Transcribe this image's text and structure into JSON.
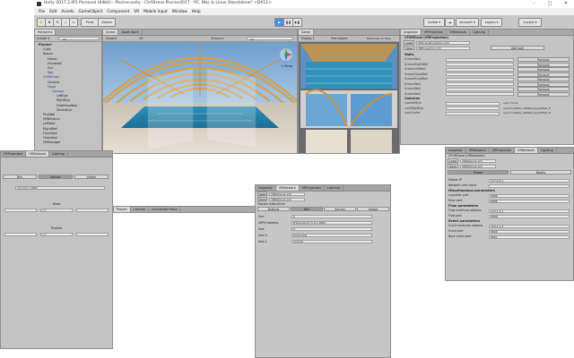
{
  "window": {
    "title": "Unity 2017.2.0f1 Personal (64bit) - Piscine.unity - CtrlStress-Piscine2017 - PC, Mac & Linux Standalone* <DX11>",
    "controls": [
      "–",
      "□",
      "✕"
    ]
  },
  "menu": [
    "File",
    "Edit",
    "Assets",
    "GameObject",
    "Component",
    "VR",
    "Mobile Input",
    "Window",
    "Help"
  ],
  "toolbar": {
    "pivot": "Pivot",
    "global": "Global",
    "collab": "Collab ▾",
    "account": "Account ▾",
    "layers": "Layers ▾",
    "layout": "Layout ▾"
  },
  "hierarchy": {
    "tab": "Hierarchy",
    "create": "Create ▾",
    "search": "All",
    "items": [
      {
        "label": "Piscine*",
        "depth": 0,
        "blue": false
      },
      {
        "label": "Cube",
        "depth": 1,
        "blue": false
      },
      {
        "label": "Bassin",
        "depth": 1,
        "blue": false
      },
      {
        "label": "Diesel",
        "depth": 2,
        "blue": false
      },
      {
        "label": "Handzest",
        "depth": 2,
        "blue": false
      },
      {
        "label": "Sun",
        "depth": 2,
        "blue": false
      },
      {
        "label": "Sun",
        "depth": 2,
        "blue": false
      },
      {
        "label": "CXVRCave",
        "depth": 1,
        "blue": true
      },
      {
        "label": "Camera",
        "depth": 2,
        "blue": false
      },
      {
        "label": "Head",
        "depth": 2,
        "blue": true
      },
      {
        "label": "Cyclops",
        "depth": 3,
        "blue": true
      },
      {
        "label": "LeftEye",
        "depth": 4,
        "blue": false
      },
      {
        "label": "RightEye",
        "depth": 4,
        "blue": false
      },
      {
        "label": "FadeHeadBox",
        "depth": 4,
        "blue": false
      },
      {
        "label": "StereoEye",
        "depth": 4,
        "blue": false
      },
      {
        "label": "PhyWall",
        "depth": 1,
        "blue": false
      },
      {
        "label": "VRNetwork",
        "depth": 1,
        "blue": false
      },
      {
        "label": "LeftWall",
        "depth": 1,
        "blue": false
      },
      {
        "label": "RightWall",
        "depth": 1,
        "blue": false
      },
      {
        "label": "FrontWall",
        "depth": 1,
        "blue": false
      },
      {
        "label": "FloorWall",
        "depth": 1,
        "blue": false
      },
      {
        "label": "VRManager",
        "depth": 1,
        "blue": false
      }
    ]
  },
  "scene": {
    "tabs": [
      "Scene",
      "Asset Store"
    ],
    "shaded": "Shaded",
    "mode2d": "2D",
    "gizmos": "Gizmos ▾",
    "search": "All",
    "persp": "< Persp"
  },
  "game": {
    "tabs": [
      "Display 1",
      "Free Aspect"
    ],
    "scale": "Scale",
    "maximize": "Maximize On Play"
  },
  "inspector": {
    "tabs": [
      "Inspector",
      "VRProjection",
      "VRNetwork",
      "Lighting"
    ],
    "header": "CFVMCave (VRProjection)",
    "load": "Load",
    "file1": "VRSceneProjection.xml",
    "save": "Save",
    "file2": "VRProjection.xml",
    "add_wall": "Add wall",
    "walls_label": "Walls",
    "walls": [
      {
        "name": "ScreenWall",
        "action": "Remove"
      },
      {
        "name": "ScreenRightWall",
        "action": "Remove"
      },
      {
        "name": "ScreenLeftWall",
        "action": "Remove"
      },
      {
        "name": "ScreenFloorWall",
        "action": "Remove"
      },
      {
        "name": "ScreenFrontWall",
        "action": "Remove"
      },
      {
        "name": "ScreenWall",
        "action": "Remove"
      },
      {
        "name": "ScreenWall",
        "action": "Remove"
      },
      {
        "name": "ScreenWall",
        "action": "Remove"
      }
    ],
    "cameras_label": "Cameras",
    "cameras": [
      {
        "name": "camLeftEye",
        "value": "Left frame"
      },
      {
        "name": "camRightEye",
        "value": "Left frame"
      },
      {
        "name": "camCenter",
        "value": "Left frame"
      }
    ],
    "cam_notes": [
      "user frame",
      "use FrontWall_LeftWall_RightWall_Fr",
      "use FrontWall_LeftWall_RightWall_Fr"
    ]
  },
  "left_window": {
    "tabs": [
      "VRProjection",
      "VRNetwork",
      "Lighting"
    ],
    "buttons": [
      "Bits",
      "Senses",
      "Viewer"
    ],
    "ip": "127.0.0.1 3883",
    "section1": "Head",
    "section2": "Flystick",
    "vec_labels": [
      "X",
      "Y",
      "Z"
    ],
    "vec_values": [
      "0",
      "1.7",
      "0"
    ]
  },
  "mid_window": {
    "tabs": [
      "Inspector",
      "VRNetwork",
      "VRProjection",
      "Lighting"
    ],
    "load": "Load",
    "file1": "VRNetwork.xml",
    "save": "Save",
    "file2": "VRNetwork.xml",
    "title": "Tracker data timer",
    "buttons": [
      "Buttons",
      "Bits",
      "Senses",
      "Viewer"
    ],
    "fields": [
      {
        "label": "Size",
        "value": "0"
      },
      {
        "label": "VRPN Address",
        "value": "DTrack@127.0.0.1:3883"
      },
      {
        "label": "Size",
        "value": "0"
      },
      {
        "label": "Axis 0",
        "value": "Horizontal"
      },
      {
        "label": "Axis 1",
        "value": "Vertical"
      }
    ]
  },
  "right_window": {
    "tabs": [
      "Inspector",
      "VRNetwork",
      "VRProjection",
      "VRNetwork",
      "Lighting"
    ],
    "header": "CFVMCave (VRNetwork)",
    "load": "Load",
    "file1": "VRNetwork.xml",
    "save": "Save",
    "file2": "VRNetwork.xml",
    "subtabs": [
      "Global",
      "Nodes"
    ],
    "fields": [
      {
        "label": "Master IP",
        "value": "127.0.0.1"
      },
      {
        "label": "Network card name",
        "value": ""
      }
    ],
    "misc_label": "Miscellaneous parameters",
    "misc": [
      {
        "label": "Launcher port",
        "value": "8888"
      },
      {
        "label": "Error port",
        "value": "8886"
      }
    ],
    "flow_label": "Flow parameters",
    "flow": [
      {
        "label": "Flow multicast address",
        "value": "224.1.1.1"
      },
      {
        "label": "Flow port",
        "value": "8889"
      }
    ],
    "event_label": "Event parameters",
    "event": [
      {
        "label": "Event multicast address",
        "value": "224.1.1.2"
      },
      {
        "label": "Event port",
        "value": "8890"
      },
      {
        "label": "Back event port",
        "value": "8891"
      }
    ]
  },
  "project": {
    "tabs": [
      "Project",
      "Console",
      "Connected Place"
    ]
  }
}
